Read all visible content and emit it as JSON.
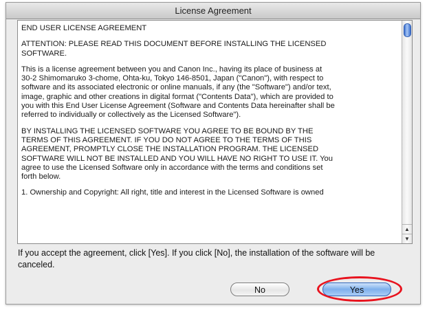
{
  "window": {
    "title": "License Agreement"
  },
  "license": {
    "paragraphs": [
      "END USER LICENSE AGREEMENT",
      "ATTENTION: PLEASE READ THIS DOCUMENT BEFORE INSTALLING THE LICENSED\nSOFTWARE.",
      "This is a license agreement between you and Canon Inc., having its place of business at\n30-2 Shimomaruko 3-chome, Ohta-ku, Tokyo 146-8501, Japan (\"Canon\"), with respect to\nsoftware and its associated electronic or online manuals, if any (the \"Software\") and/or text,\nimage, graphic and other creations in digital format (\"Contents Data\"), which are provided to\nyou with this End User License Agreement (Software and Contents Data hereinafter shall be\nreferred to individually or collectively as the Licensed Software\").",
      "BY INSTALLING THE LICENSED SOFTWARE YOU AGREE TO BE BOUND BY THE\nTERMS OF THIS AGREEMENT. IF YOU DO NOT AGREE TO THE TERMS OF THIS\nAGREEMENT, PROMPTLY CLOSE THE INSTALLATION PROGRAM. THE LICENSED\nSOFTWARE WILL NOT BE INSTALLED AND YOU WILL HAVE NO RIGHT TO USE IT. You\nagree to use the Licensed Software only in accordance with the terms and conditions set\nforth below.",
      "1. Ownership and Copyright: All right, title and interest in the Licensed Software is owned"
    ]
  },
  "instruction": "If you accept the agreement, click [Yes]. If you click [No], the installation of the software will be canceled.",
  "buttons": {
    "no_label": "No",
    "yes_label": "Yes"
  },
  "colors": {
    "highlight": "#e8131e",
    "default_button": "#7fb0ec"
  },
  "icons": {
    "scroll_up": "up-arrow",
    "scroll_down": "down-arrow"
  }
}
